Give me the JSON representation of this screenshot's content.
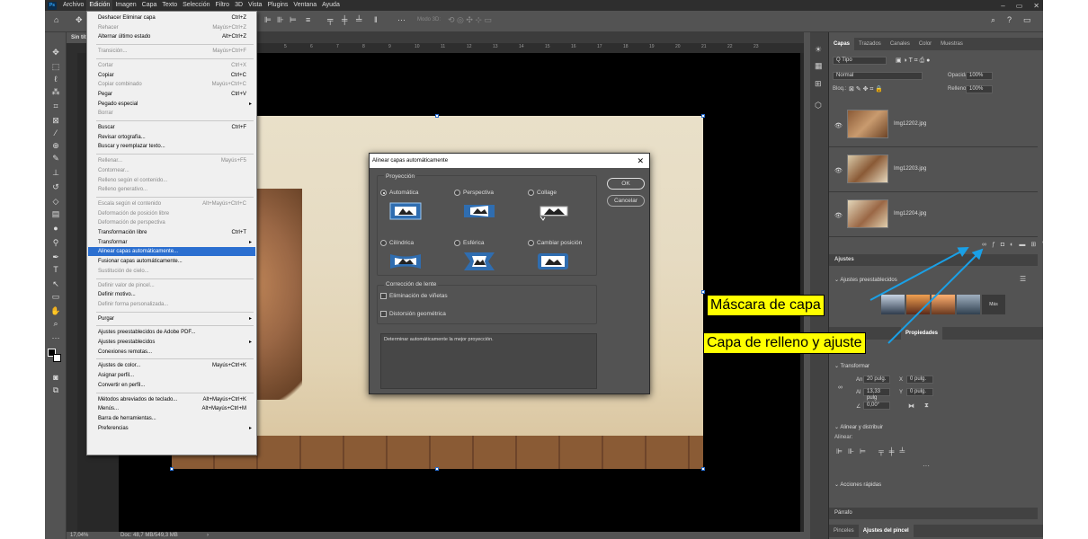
{
  "app": {
    "logo": "Ps",
    "title_tab": "Sin tít",
    "window_controls": [
      "–",
      "▭",
      "✕"
    ]
  },
  "menubar": [
    "Archivo",
    "Edición",
    "Imagen",
    "Capa",
    "Texto",
    "Selección",
    "Filtro",
    "3D",
    "Vista",
    "Plugins",
    "Ventana",
    "Ayuda"
  ],
  "optionsbar": {
    "mode3d": "Modo 3D:"
  },
  "ruler_ticks": [
    "5",
    "6",
    "7",
    "8",
    "9",
    "10",
    "11",
    "12",
    "13",
    "14",
    "15",
    "16",
    "17",
    "18",
    "19",
    "20",
    "21",
    "22",
    "23"
  ],
  "status": {
    "zoom": "17,04%",
    "doc": "Doc: 48,7 MB/549,3 MB"
  },
  "edit_menu": [
    {
      "label": "Deshacer Eliminar capa",
      "shortcut": "Ctrl+Z",
      "disabled": false
    },
    {
      "label": "Rehacer",
      "shortcut": "Mayús+Ctrl+Z",
      "disabled": true
    },
    {
      "label": "Alternar último estado",
      "shortcut": "Alt+Ctrl+Z",
      "disabled": false
    },
    {
      "label": "Transición...",
      "shortcut": "Mayús+Ctrl+F",
      "disabled": true
    },
    {
      "label": "Cortar",
      "shortcut": "Ctrl+X",
      "disabled": true
    },
    {
      "label": "Copiar",
      "shortcut": "Ctrl+C",
      "disabled": false
    },
    {
      "label": "Copiar combinado",
      "shortcut": "Mayús+Ctrl+C",
      "disabled": true
    },
    {
      "label": "Pegar",
      "shortcut": "Ctrl+V",
      "disabled": false
    },
    {
      "label": "Pegado especial",
      "shortcut": "",
      "disabled": false,
      "submenu": true
    },
    {
      "label": "Borrar",
      "shortcut": "",
      "disabled": true
    },
    {
      "label": "Buscar",
      "shortcut": "Ctrl+F",
      "disabled": false
    },
    {
      "label": "Revisar ortografía...",
      "shortcut": "",
      "disabled": false
    },
    {
      "label": "Buscar y reemplazar texto...",
      "shortcut": "",
      "disabled": false
    },
    {
      "label": "Rellenar...",
      "shortcut": "Mayús+F5",
      "disabled": true
    },
    {
      "label": "Contornear...",
      "shortcut": "",
      "disabled": true
    },
    {
      "label": "Relleno según el contenido...",
      "shortcut": "",
      "disabled": true
    },
    {
      "label": "Relleno generativo...",
      "shortcut": "",
      "disabled": true
    },
    {
      "label": "Escala según el contenido",
      "shortcut": "Alt+Mayús+Ctrl+C",
      "disabled": true
    },
    {
      "label": "Deformación de posición libre",
      "shortcut": "",
      "disabled": true
    },
    {
      "label": "Deformación de perspectiva",
      "shortcut": "",
      "disabled": true
    },
    {
      "label": "Transformación libre",
      "shortcut": "Ctrl+T",
      "disabled": false
    },
    {
      "label": "Transformar",
      "shortcut": "",
      "disabled": false,
      "submenu": true
    },
    {
      "label": "Alinear capas automáticamente...",
      "shortcut": "",
      "disabled": false,
      "highlight": true
    },
    {
      "label": "Fusionar capas automáticamente...",
      "shortcut": "",
      "disabled": false
    },
    {
      "label": "Sustitución de cielo...",
      "shortcut": "",
      "disabled": true
    },
    {
      "label": "Definir valor de pincel...",
      "shortcut": "",
      "disabled": true
    },
    {
      "label": "Definir motivo...",
      "shortcut": "",
      "disabled": false
    },
    {
      "label": "Definir forma personalizada...",
      "shortcut": "",
      "disabled": true
    },
    {
      "label": "Purgar",
      "shortcut": "",
      "disabled": false,
      "submenu": true
    },
    {
      "label": "Ajustes preestablecidos de Adobe PDF...",
      "shortcut": "",
      "disabled": false
    },
    {
      "label": "Ajustes preestablecidos",
      "shortcut": "",
      "disabled": false,
      "submenu": true
    },
    {
      "label": "Conexiones remotas...",
      "shortcut": "",
      "disabled": false
    },
    {
      "label": "Ajustes de color...",
      "shortcut": "Mayús+Ctrl+K",
      "disabled": false
    },
    {
      "label": "Asignar perfil...",
      "shortcut": "",
      "disabled": false
    },
    {
      "label": "Convertir en perfil...",
      "shortcut": "",
      "disabled": false
    },
    {
      "label": "Métodos abreviados de teclado...",
      "shortcut": "Alt+Mayús+Ctrl+K",
      "disabled": false
    },
    {
      "label": "Menús...",
      "shortcut": "Alt+Mayús+Ctrl+M",
      "disabled": false
    },
    {
      "label": "Barra de herramientas...",
      "shortcut": "",
      "disabled": false
    },
    {
      "label": "Preferencias",
      "shortcut": "",
      "disabled": false,
      "submenu": true
    }
  ],
  "dialog": {
    "title": "Alinear capas automáticamente",
    "close": "✕",
    "projection_label": "Proyección",
    "options": [
      {
        "label": "Automática",
        "selected": true
      },
      {
        "label": "Perspectiva",
        "selected": false
      },
      {
        "label": "Collage",
        "selected": false
      },
      {
        "label": "Cilíndrica",
        "selected": false
      },
      {
        "label": "Esférica",
        "selected": false
      },
      {
        "label": "Cambiar posición",
        "selected": false
      }
    ],
    "lens_label": "Corrección de lente",
    "vignette": "Eliminación de viñetas",
    "distortion": "Distorsión geométrica",
    "description": "Determinar automáticamente la mejor proyección.",
    "ok": "OK",
    "cancel": "Cancelar"
  },
  "panels": {
    "tabs": [
      "Capas",
      "Trazados",
      "Canales",
      "Color",
      "Muestras"
    ],
    "filter": "Q Tipo",
    "blend": "Normal",
    "opacity_label": "Opacidad:",
    "opacity": "100%",
    "lock_label": "Bloq.:",
    "fill_label": "Relleno:",
    "fill": "100%",
    "layers": [
      {
        "name": "Img12202.jpg"
      },
      {
        "name": "Img12203.jpg"
      },
      {
        "name": "Img12204.jpg"
      }
    ],
    "ajustes_title": "Ajustes",
    "ajustes_presets": "Ajustes preestablecidos",
    "more": "Más",
    "props_tab": "Propiedades",
    "transform_label": "Transformar",
    "an_label": "An",
    "an": "20 pulg.",
    "al_label": "Al",
    "al": "13,33 pulg",
    "x_label": "X",
    "x": "0 pulg.",
    "y_label": "Y",
    "y": "0 pulg.",
    "angle": "0,00°",
    "align_label": "Alinear y distribuir",
    "align_sub": "Alinear:",
    "quick_actions": "Acciones rápidas",
    "parrafo": "Párrafo",
    "bottom_tabs": [
      "Pinceles",
      "Ajustes del pincel"
    ]
  },
  "callouts": {
    "mask": "Máscara de capa",
    "fill_adjust": "Capa de relleno y ajuste"
  },
  "colors": {
    "accent": "#2b6fd0",
    "callout_bg": "#ffff00",
    "arrow": "#1aa0e6"
  }
}
